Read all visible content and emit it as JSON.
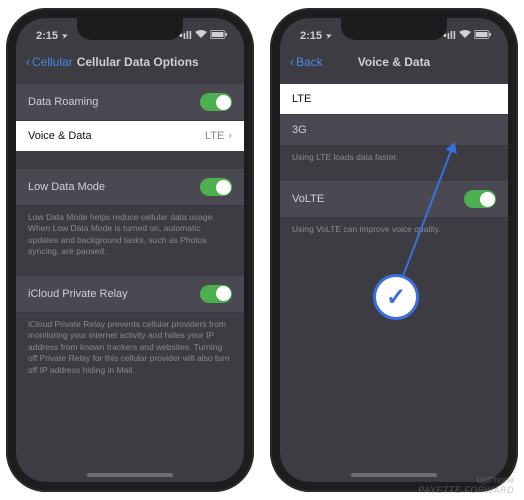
{
  "status": {
    "time": "2:15",
    "location_icon": "➤",
    "signal_icon": "•ıll",
    "wifi_icon": "▲",
    "battery_icon": "■"
  },
  "left_screen": {
    "nav": {
      "back_label": "Cellular",
      "title": "Cellular Data Options"
    },
    "section1": {
      "data_roaming": {
        "label": "Data Roaming",
        "on": true
      },
      "voice_data": {
        "label": "Voice & Data",
        "value": "LTE"
      }
    },
    "section2": {
      "low_data_mode": {
        "label": "Low Data Mode",
        "on": true
      },
      "note": "Low Data Mode helps reduce cellular data usage. When Low Data Mode is turned on, automatic updates and background tasks, such as Photos syncing, are paused."
    },
    "section3": {
      "icloud_relay": {
        "label": "iCloud Private Relay",
        "on": true
      },
      "note": "iCloud Private Relay prevents cellular providers from monitoring your internet activity and hides your IP address from known trackers and websites. Turning off Private Relay for this cellular provider will also turn off IP address hiding in Mail."
    }
  },
  "right_screen": {
    "nav": {
      "back_label": "Back",
      "title": "Voice & Data"
    },
    "options": {
      "lte": {
        "label": "LTE"
      },
      "g3": {
        "label": "3G"
      },
      "note1": "Using LTE loads data faster."
    },
    "volte_section": {
      "volte": {
        "label": "VoLTE",
        "on": true
      },
      "note": "Using VoLTE can improve voice quality."
    }
  },
  "watermark": {
    "line1": "UpPhone",
    "line2": "PAYETTE FORWARD"
  }
}
